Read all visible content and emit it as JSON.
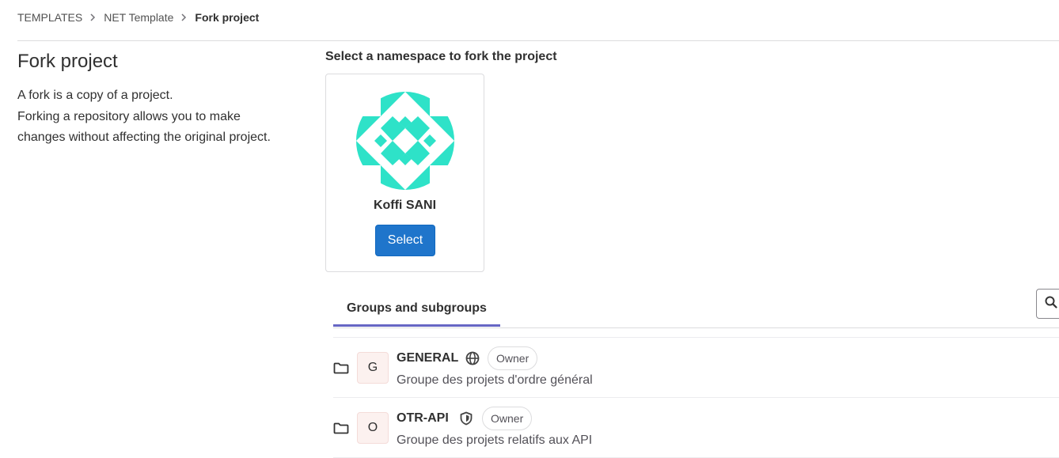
{
  "breadcrumb": {
    "items": [
      "TEMPLATES",
      "NET Template"
    ],
    "current": "Fork project"
  },
  "page": {
    "title": "Fork project",
    "description_lines": [
      "A fork is a copy of a project.",
      "Forking a repository allows you to make",
      "changes without affecting the original project."
    ]
  },
  "namespace": {
    "heading": "Select a namespace to fork the project",
    "user_name": "Koffi SANI",
    "select_label": "Select",
    "avatar_color": "#2ee2c8"
  },
  "tabs": [
    {
      "label": "Groups and subgroups",
      "active": true
    }
  ],
  "search": {
    "icon": "search-icon"
  },
  "groups": [
    {
      "initial": "G",
      "name": "GENERAL",
      "visibility_icon": "globe-icon",
      "role": "Owner",
      "description": "Groupe des projets d'ordre général"
    },
    {
      "initial": "O",
      "name": "OTR-API",
      "visibility_icon": "shield-icon",
      "role": "Owner",
      "description": "Groupe des projets relatifs aux API"
    }
  ],
  "colors": {
    "primary_button": "#1f75cb",
    "tab_underline": "#6666c4",
    "group_avatar_bg": "#fcf1ef"
  }
}
